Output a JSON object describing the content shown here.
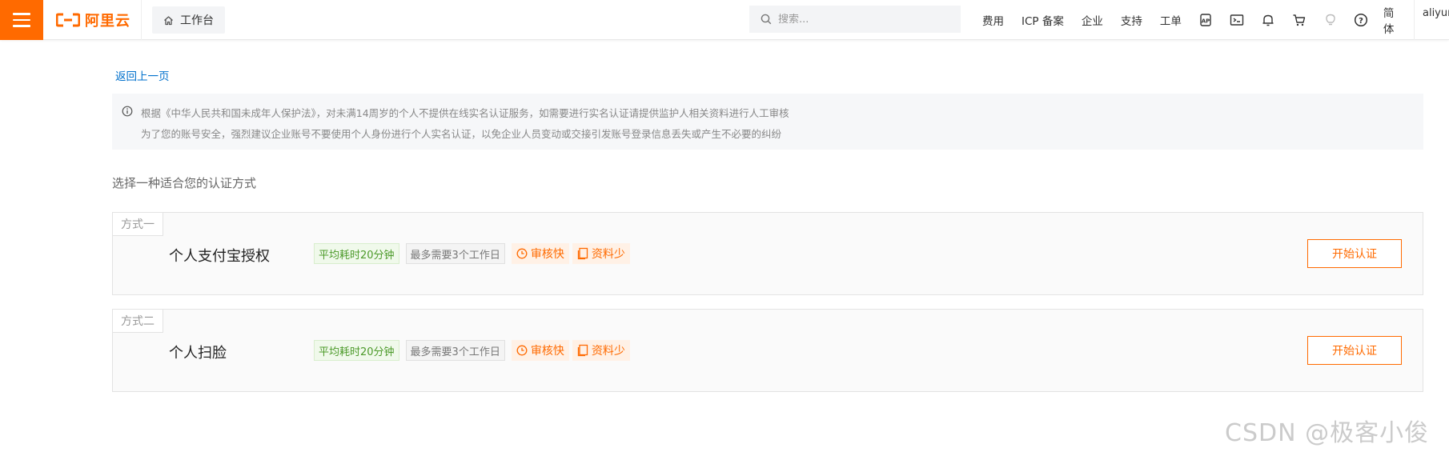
{
  "header": {
    "brand": "阿里云",
    "workbench_label": "工作台",
    "search_placeholder": "搜索...",
    "nav": [
      "费用",
      "ICP 备案",
      "企业",
      "支持",
      "工单"
    ],
    "icons": [
      "api-icon",
      "terminal-icon",
      "bell-icon",
      "cart-icon",
      "lightbulb-icon",
      "help-icon"
    ],
    "lang": "简体",
    "user": "aliyun"
  },
  "page": {
    "back_link": "返回上一页",
    "notice_line1": "根据《中华人民共和国未成年人保护法》，对未满14周岁的个人不提供在线实名认证服务，如需要进行实名认证请提供监护人相关资料进行人工审核",
    "notice_line2": "为了您的账号安全，强烈建议企业账号不要使用个人身份进行个人实名认证，以免企业人员变动或交接引发账号登录信息丢失或产生不必要的纠纷",
    "section_title": "选择一种适合您的认证方式"
  },
  "methods": [
    {
      "tag": "方式一",
      "name": "个人支付宝授权",
      "badge_time": "平均耗时20分钟",
      "badge_days": "最多需要3个工作日",
      "badge_fast": "审核快",
      "badge_less": "资料少",
      "button": "开始认证"
    },
    {
      "tag": "方式二",
      "name": "个人扫脸",
      "badge_time": "平均耗时20分钟",
      "badge_days": "最多需要3个工作日",
      "badge_fast": "审核快",
      "badge_less": "资料少",
      "button": "开始认证"
    }
  ],
  "watermark": "CSDN @极客小俊",
  "colors": {
    "brand_orange": "#ff6a00",
    "link_blue": "#0070cc",
    "green_badge": "#4c9a2a"
  }
}
